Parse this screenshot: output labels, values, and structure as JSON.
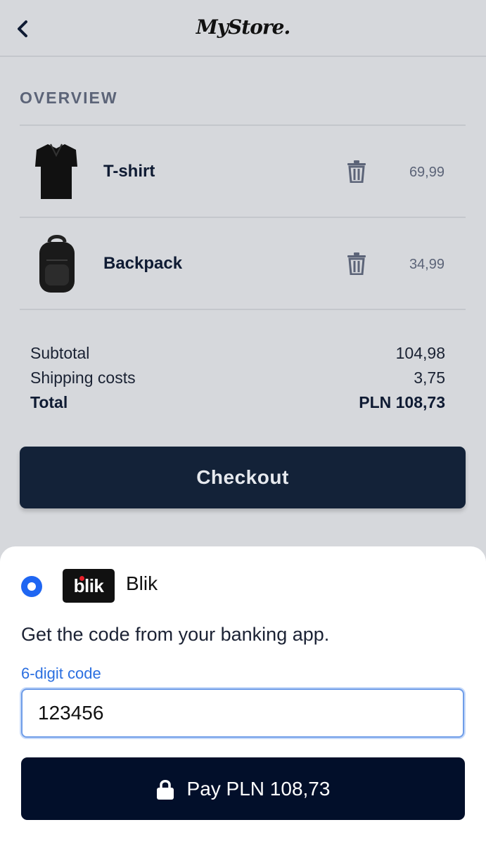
{
  "header": {
    "logo_text": "MyStore.",
    "back_icon": "chevron-left-icon"
  },
  "overview": {
    "title": "OVERVIEW",
    "items": [
      {
        "name": "T-shirt",
        "price": "69,99",
        "image": "tshirt-image",
        "remove_icon": "trash-icon"
      },
      {
        "name": "Backpack",
        "price": "34,99",
        "image": "backpack-image",
        "remove_icon": "trash-icon"
      }
    ]
  },
  "summary": {
    "subtotal_label": "Subtotal",
    "subtotal_value": "104,98",
    "shipping_label": "Shipping costs",
    "shipping_value": "3,75",
    "total_label": "Total",
    "total_value": "PLN 108,73"
  },
  "checkout_label": "Checkout",
  "payment": {
    "method_name": "Blik",
    "method_logo_text": "blik",
    "selected": true,
    "instruction": "Get the code from your banking app.",
    "code_label": "6-digit code",
    "code_value": "123456",
    "pay_label": "Pay PLN 108,73",
    "pay_icon": "lock-icon"
  },
  "colors": {
    "background": "#d6d8dc",
    "primary_dark": "#132238",
    "pay_button": "#020f2a",
    "accent_blue": "#1f66f2",
    "muted_text": "#5c6478"
  }
}
